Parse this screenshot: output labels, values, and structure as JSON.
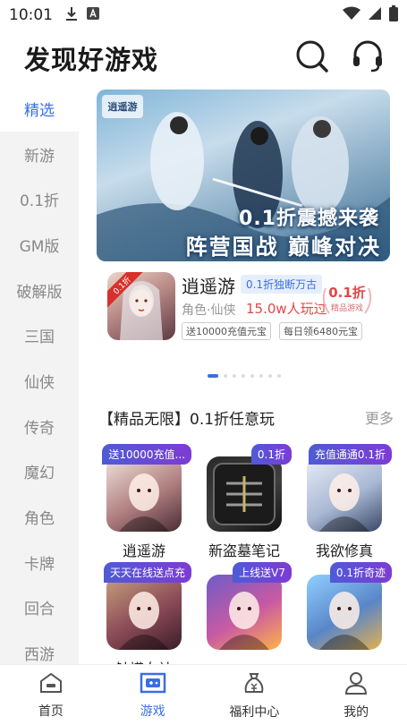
{
  "status": {
    "time": "10:01",
    "icons_left": [
      "download-icon",
      "a-icon"
    ],
    "icons_right": [
      "wifi-icon",
      "cellular-icon",
      "battery-icon"
    ]
  },
  "header": {
    "title": "发现好游戏",
    "search_icon": "search-icon",
    "support_icon": "headset-icon"
  },
  "sidebar": {
    "items": [
      "精选",
      "新游",
      "0.1折",
      "GM版",
      "破解版",
      "三国",
      "仙侠",
      "传奇",
      "魔幻",
      "角色",
      "卡牌",
      "回合",
      "西游"
    ],
    "active_index": 0
  },
  "banner": {
    "logo": "逍遥游",
    "line1": "0.1折震撼来袭",
    "line2": "阵营国战 巅峰对决"
  },
  "feature": {
    "corner": "0.1折",
    "name": "逍遥游",
    "chip": "0.1折独断万古",
    "genre": "角色·仙侠",
    "players": "15.0w人玩过",
    "seal_big": "0.1折",
    "seal_small": "精品游戏",
    "tags": [
      "送10000充值元宝",
      "每日领6480元宝"
    ]
  },
  "carousel": {
    "count": 8,
    "active": 0
  },
  "section": {
    "title": "【精品无限】0.1折任意玩",
    "more": "更多"
  },
  "games": [
    {
      "badge": "送10000充值...",
      "name": "逍遥游"
    },
    {
      "badge": "0.1折",
      "name": "新盗墓笔记"
    },
    {
      "badge": "充值通通0.1折",
      "name": "我欲修真"
    },
    {
      "badge": "天天在线送点充",
      "name": "触摸女神"
    },
    {
      "badge": "上线送V7",
      "name": ""
    },
    {
      "badge": "0.1折奇迹",
      "name": ""
    }
  ],
  "tabbar": {
    "items": [
      {
        "label": "首页",
        "icon": "home-icon"
      },
      {
        "label": "游戏",
        "icon": "gamepad-icon"
      },
      {
        "label": "福利中心",
        "icon": "money-bag-icon"
      },
      {
        "label": "我的",
        "icon": "user-icon"
      }
    ],
    "active_index": 1
  },
  "colors": {
    "accent": "#3a6fe0",
    "price_red": "#e24646",
    "sidebar_bg": "#f3f3f3"
  }
}
